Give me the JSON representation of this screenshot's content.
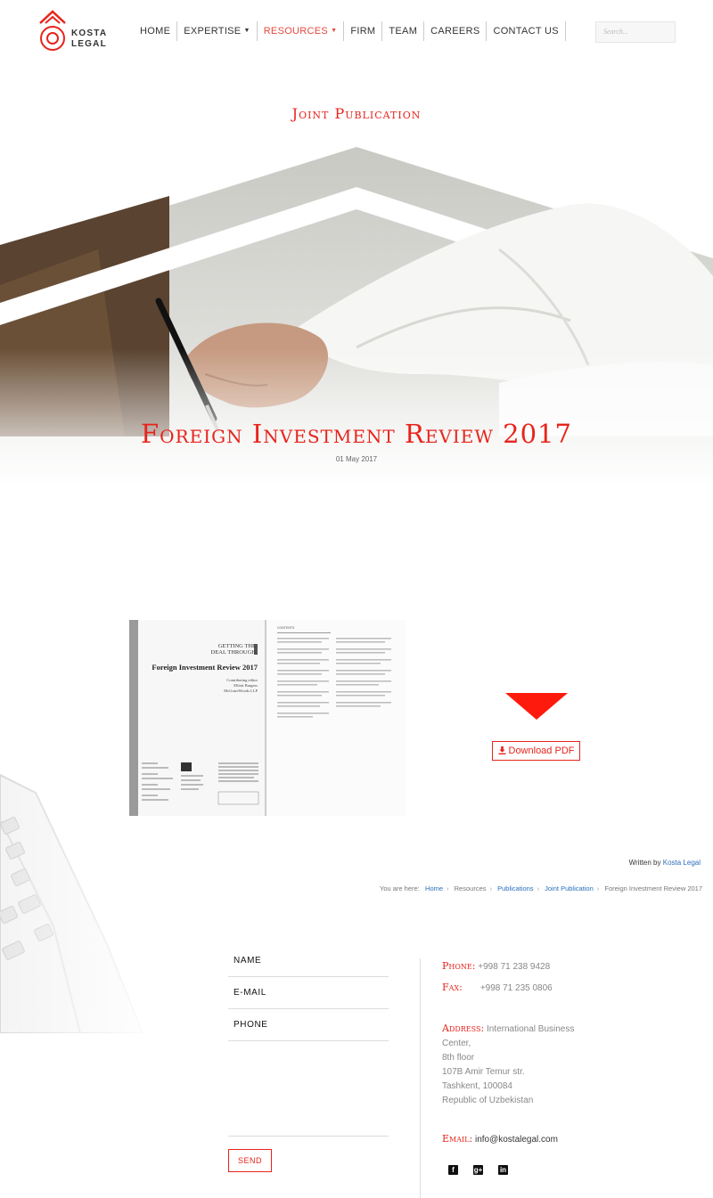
{
  "brand": {
    "line1": "KOSTA",
    "line2": "LEGAL"
  },
  "nav": [
    {
      "label": "HOME",
      "dropdown": false,
      "active": false
    },
    {
      "label": "EXPERTISE",
      "dropdown": true,
      "active": false
    },
    {
      "label": "RESOURCES",
      "dropdown": true,
      "active": true
    },
    {
      "label": "FIRM",
      "dropdown": false,
      "active": false
    },
    {
      "label": "TEAM",
      "dropdown": false,
      "active": false
    },
    {
      "label": "CAREERS",
      "dropdown": false,
      "active": false
    },
    {
      "label": "CONTACT US",
      "dropdown": false,
      "active": false
    }
  ],
  "search": {
    "placeholder": "Search..."
  },
  "hero": {
    "category": "Joint Publication",
    "title": "Foreign Investment Review 2017",
    "date": "01 May 2017"
  },
  "book": {
    "series_line1": "GETTING THE",
    "series_line2": "DEAL THROUGH",
    "title": "Foreign Investment Review 2017",
    "editor_line1": "Contributing editor",
    "editor_line2": "Elliott Burgess",
    "editor_line3": "McGuireWoods LLP",
    "contents_label": "CONTENTS"
  },
  "download": {
    "label": "Download PDF"
  },
  "written": {
    "prefix": "Written by",
    "author": "Kosta Legal"
  },
  "breadcrumbs": {
    "prefix": "You are here:",
    "items": [
      "Home",
      "Resources",
      "Publications",
      "Joint Publication",
      "Foreign Investment Review 2017"
    ]
  },
  "form": {
    "name": "NAME",
    "email": "E-MAIL",
    "phone": "PHONE",
    "send": "SEND"
  },
  "contact": {
    "phone_label": "Phone:",
    "phone": "+998 71 238 9428",
    "fax_label": "Fax:",
    "fax": "+998 71 235 0806",
    "address_label": "Address:",
    "address_lines": [
      "International Business Center,",
      "8th floor",
      "107B Amir Temur str.",
      "Tashkent, 100084",
      "Republic of Uzbekistan"
    ],
    "email_label": "Email:",
    "email": "info@kostalegal.com"
  },
  "socials": [
    {
      "icon": "facebook-icon",
      "glyph": "f"
    },
    {
      "icon": "google-plus-icon",
      "glyph": "g+"
    },
    {
      "icon": "linkedin-icon",
      "glyph": "in"
    }
  ],
  "colors": {
    "accent": "#e8241c",
    "link": "#2a6ebd"
  }
}
